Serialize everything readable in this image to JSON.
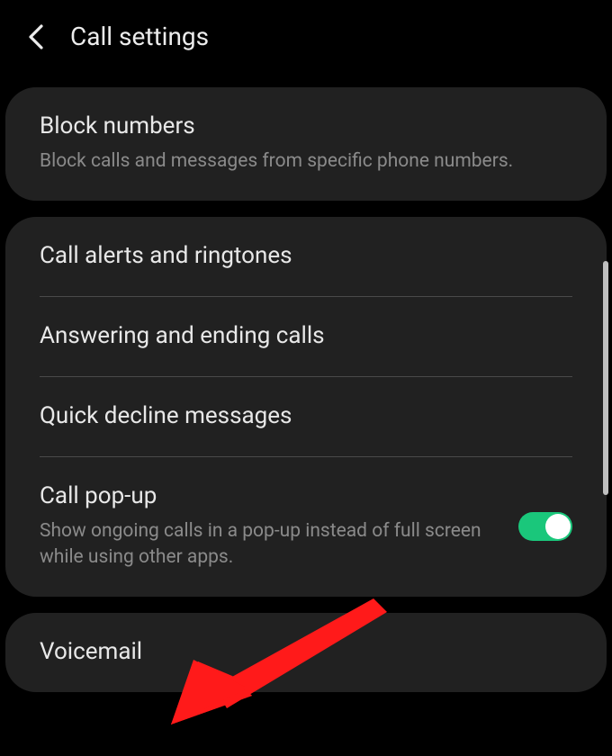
{
  "header": {
    "title": "Call settings"
  },
  "card1": {
    "block_numbers": {
      "title": "Block numbers",
      "subtitle": "Block calls and messages from specific phone numbers."
    }
  },
  "card2": {
    "call_alerts": {
      "title": "Call alerts and ringtones"
    },
    "answering": {
      "title": "Answering and ending calls"
    },
    "quick_decline": {
      "title": "Quick decline messages"
    },
    "call_popup": {
      "title": "Call pop-up",
      "subtitle": "Show ongoing calls in a pop-up instead of full screen while using other apps."
    }
  },
  "card3": {
    "voicemail": {
      "title": "Voicemail"
    }
  },
  "toggle": {
    "call_popup_on": true
  },
  "annotation": {
    "arrow_color": "#ff1a1a"
  }
}
